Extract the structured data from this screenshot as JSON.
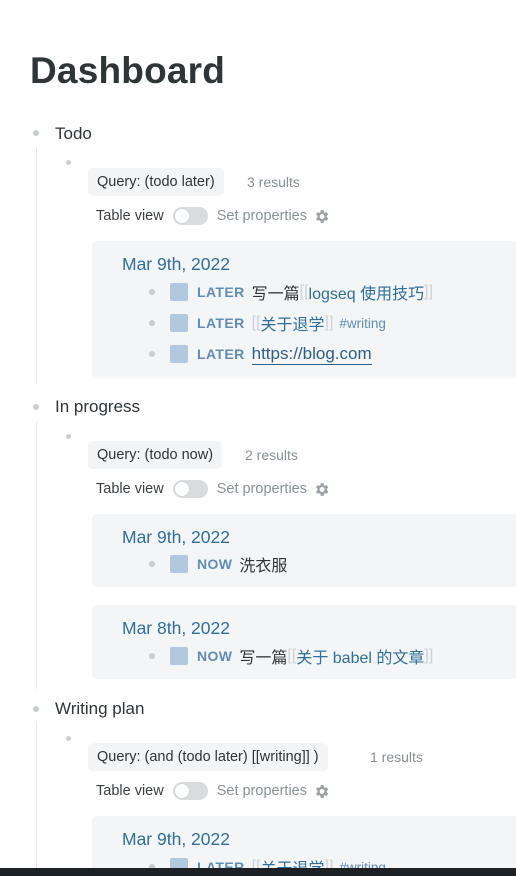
{
  "page": {
    "title": "Dashboard"
  },
  "sections": [
    {
      "label": "Todo",
      "query": "Query: (todo later)",
      "results": "3 results",
      "table_view": "Table view",
      "set_properties": "Set properties",
      "groups": [
        {
          "date": "Mar 9th, 2022",
          "tasks": [
            {
              "marker": "LATER",
              "prefix": "写一篇",
              "open": "[[",
              "ref": "logseq 使用技巧",
              "close": "]]"
            },
            {
              "marker": "LATER",
              "open": "[[",
              "ref": "关于退学",
              "close": "]]",
              "tag": "#writing"
            },
            {
              "marker": "LATER",
              "link": "https://blog.com"
            }
          ]
        }
      ]
    },
    {
      "label": "In progress",
      "query": "Query: (todo now)",
      "results": "2 results",
      "table_view": "Table view",
      "set_properties": "Set properties",
      "groups": [
        {
          "date": "Mar 9th, 2022",
          "tasks": [
            {
              "marker": "NOW",
              "text": "洗衣服"
            }
          ]
        },
        {
          "date": "Mar 8th, 2022",
          "tasks": [
            {
              "marker": "NOW",
              "prefix": "写一篇",
              "open": "[[",
              "ref": "关于 babel 的文章",
              "close": "]]"
            }
          ]
        }
      ]
    },
    {
      "label": "Writing plan",
      "query": "Query: (and (todo later) [[writing]] )",
      "results": "1 results",
      "table_view": "Table view",
      "set_properties": "Set properties",
      "groups": [
        {
          "date": "Mar 9th, 2022",
          "tasks": [
            {
              "marker": "LATER",
              "open": "[[",
              "ref": "关于退学",
              "close": "]]",
              "tag": "#writing"
            }
          ]
        }
      ]
    }
  ],
  "colors": {
    "accent": "#2e6f9c",
    "marker": "#5f8db5",
    "checkbox": "#b1c8de",
    "group_bg": "#f4f5f6"
  },
  "icons": {
    "gear": "gear-icon"
  }
}
